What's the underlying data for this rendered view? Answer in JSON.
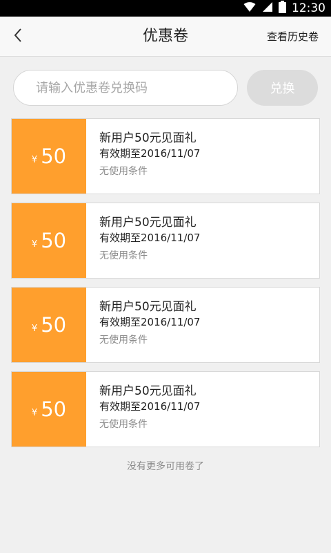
{
  "status_bar": {
    "time": "12:30",
    "icons": [
      "wifi-icon",
      "signal-icon",
      "battery-icon"
    ]
  },
  "header": {
    "title": "优惠卷",
    "history_label": "查看历史卷",
    "back_icon": "chevron-left-icon"
  },
  "redeem": {
    "placeholder": "请输入优惠卷兑换码",
    "value": "",
    "button_label": "兑换"
  },
  "coupons": [
    {
      "currency": "¥",
      "amount": "50",
      "title": "新用户50元见面礼",
      "expiry": "有效期至2016/11/07",
      "condition": "无使用条件"
    },
    {
      "currency": "¥",
      "amount": "50",
      "title": "新用户50元见面礼",
      "expiry": "有效期至2016/11/07",
      "condition": "无使用条件"
    },
    {
      "currency": "¥",
      "amount": "50",
      "title": "新用户50元见面礼",
      "expiry": "有效期至2016/11/07",
      "condition": "无使用条件"
    },
    {
      "currency": "¥",
      "amount": "50",
      "title": "新用户50元见面礼",
      "expiry": "有效期至2016/11/07",
      "condition": "无使用条件"
    }
  ],
  "footer": {
    "no_more_text": "没有更多可用卷了"
  },
  "colors": {
    "accent": "#ff9f2d",
    "button_disabled": "#dcdcdc",
    "background": "#f0f0f0"
  }
}
